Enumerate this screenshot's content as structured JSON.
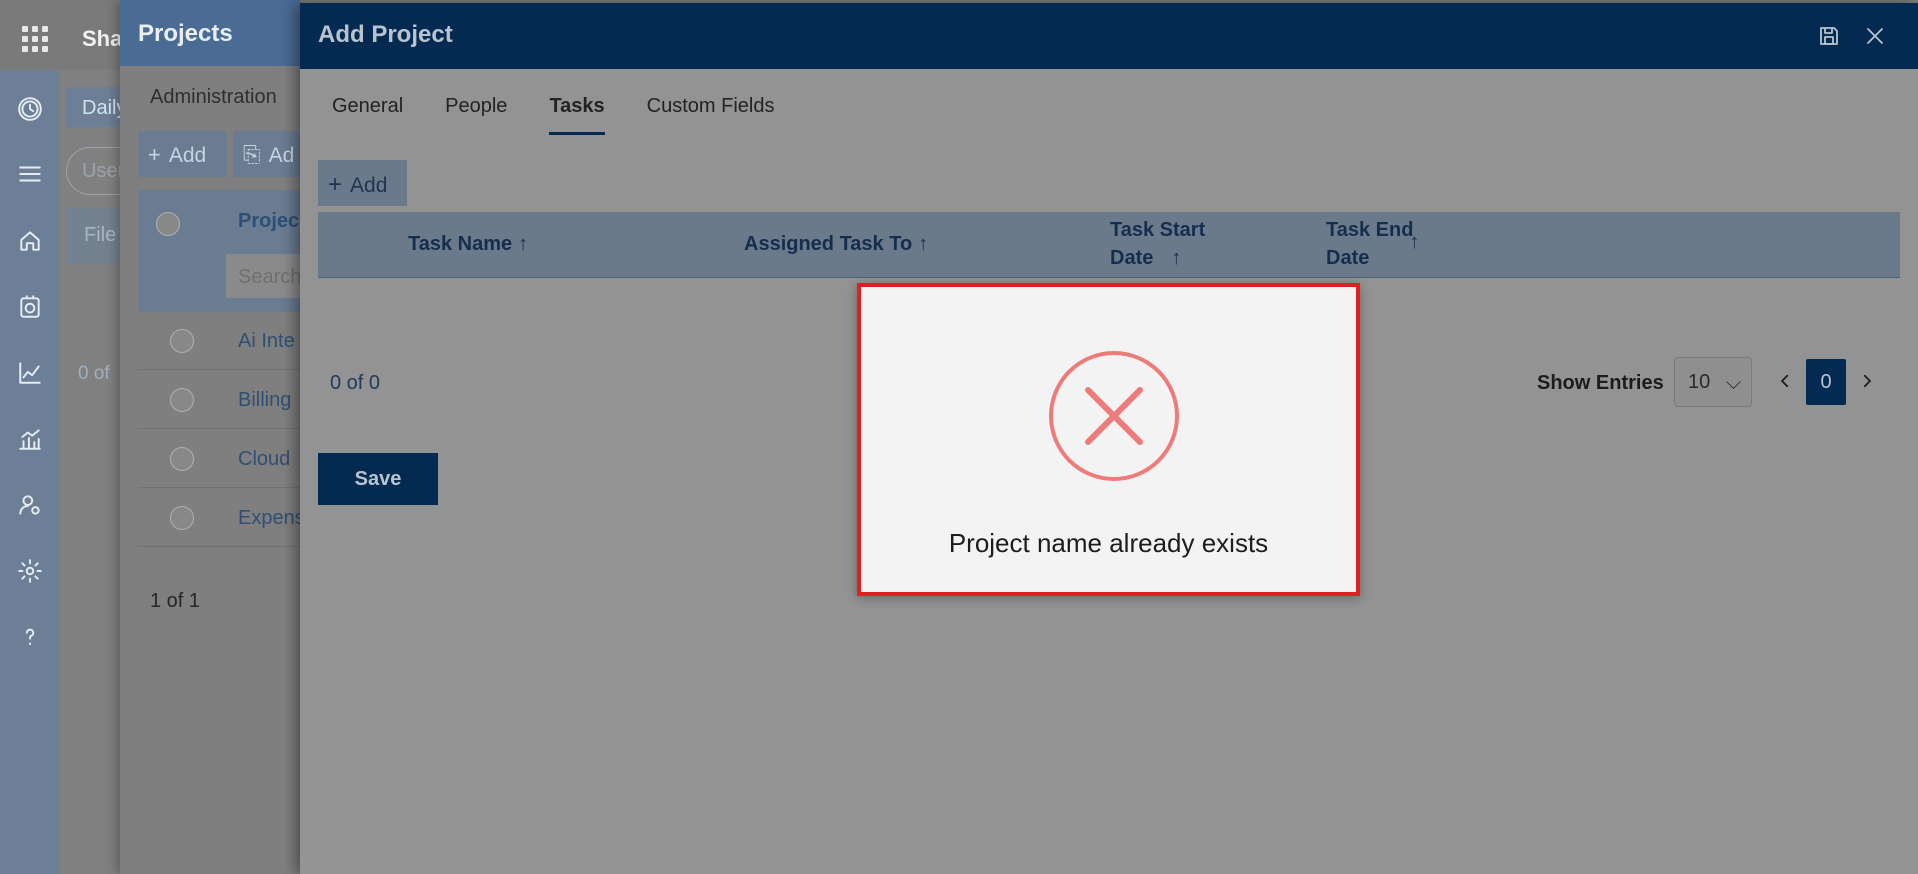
{
  "app": {
    "name": "Sha"
  },
  "left_rail": {
    "icons": [
      "clock-logo-icon",
      "hamburger-menu-icon",
      "home-icon",
      "timesheet-icon",
      "line-chart-icon",
      "bar-chart-icon",
      "user-settings-icon",
      "gear-icon",
      "help-icon"
    ]
  },
  "background": {
    "tab_label": "Daily",
    "search_placeholder": "User",
    "file_header": "File",
    "count": "0 of"
  },
  "projects_panel": {
    "title": "Projects",
    "admin_label": "Administration",
    "add_label": "Add",
    "add2_label": "Ad",
    "column_label": "Projec",
    "search_placeholder": "Search",
    "rows": [
      {
        "name": "Ai Inte"
      },
      {
        "name": "Billing"
      },
      {
        "name": "Cloud"
      },
      {
        "name": "Expens"
      }
    ],
    "count": "1 of 1"
  },
  "add_project": {
    "title": "Add Project",
    "tabs": [
      {
        "label": "General"
      },
      {
        "label": "People"
      },
      {
        "label": "Tasks"
      },
      {
        "label": "Custom Fields"
      }
    ],
    "active_tab": "Tasks",
    "add_label": "Add",
    "columns": [
      {
        "line1": "Task Name",
        "line2": "",
        "arrow": "↑"
      },
      {
        "line1": "Assigned Task To",
        "line2": "",
        "arrow": "↑"
      },
      {
        "line1": "Task Start",
        "line2": "Date",
        "arrow": "↑"
      },
      {
        "line1": "Task End",
        "line2": "Date",
        "arrow": "↑"
      }
    ],
    "count": "0 of 0",
    "show_entries_label": "Show Entries",
    "entries_value": "10",
    "current_page": "0",
    "save_label": "Save"
  },
  "modal": {
    "message": "Project name already exists",
    "border_color": "#e02020",
    "icon_color": "#ef7a7a"
  },
  "colors": {
    "header_navy": "#052a52",
    "projects_header": "#4a6b94"
  }
}
